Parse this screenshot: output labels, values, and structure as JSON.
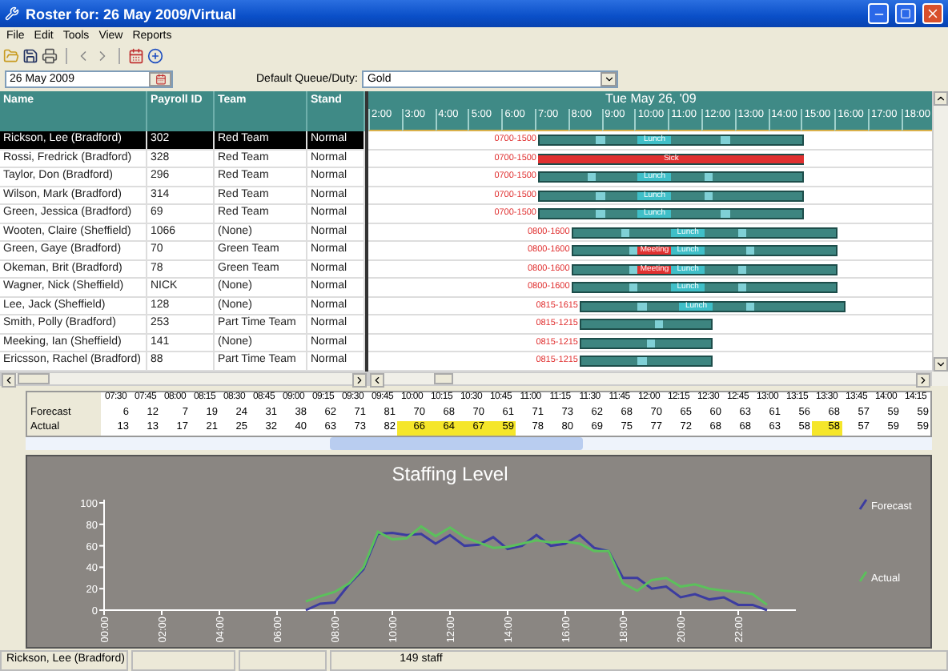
{
  "window": {
    "title": "Roster for: 26 May 2009/Virtual"
  },
  "menu": [
    "File",
    "Edit",
    "Tools",
    "View",
    "Reports"
  ],
  "filter": {
    "date": "26 May 2009",
    "queue_label": "Default Queue/Duty:",
    "queue": "Gold"
  },
  "table": {
    "columns": [
      "Name",
      "Payroll ID",
      "Team",
      "Stand"
    ],
    "rows": [
      {
        "name": "Rickson, Lee  (Bradford)",
        "payroll": "302",
        "team": "Red Team",
        "stand": "Normal",
        "selected": true
      },
      {
        "name": "Rossi, Fredrick  (Bradford)",
        "payroll": "328",
        "team": "Red Team",
        "stand": "Normal",
        "selected": false
      },
      {
        "name": "Taylor, Don  (Bradford)",
        "payroll": "296",
        "team": "Red Team",
        "stand": "Normal",
        "selected": false
      },
      {
        "name": "Wilson, Mark  (Bradford)",
        "payroll": "314",
        "team": "Red Team",
        "stand": "Normal",
        "selected": false
      },
      {
        "name": "Green, Jessica  (Bradford)",
        "payroll": "69",
        "team": "Red Team",
        "stand": "Normal",
        "selected": false
      },
      {
        "name": "Wooten, Claire  (Sheffield)",
        "payroll": "1066",
        "team": "(None)",
        "stand": "Normal",
        "selected": false
      },
      {
        "name": "Green, Gaye  (Bradford)",
        "payroll": "70",
        "team": "Green Team",
        "stand": "Normal",
        "selected": false
      },
      {
        "name": "Okeman, Brit  (Bradford)",
        "payroll": "78",
        "team": "Green Team",
        "stand": "Normal",
        "selected": false
      },
      {
        "name": "Wagner, Nick  (Sheffield)",
        "payroll": "NICK",
        "team": "(None)",
        "stand": "Normal",
        "selected": false
      },
      {
        "name": "Lee, Jack  (Sheffield)",
        "payroll": "128",
        "team": "(None)",
        "stand": "Normal",
        "selected": false
      },
      {
        "name": "Smith, Polly  (Bradford)",
        "payroll": "253",
        "team": "Part Time Team",
        "stand": "Normal",
        "selected": false
      },
      {
        "name": "Meeking, Ian  (Sheffield)",
        "payroll": "141",
        "team": "(None)",
        "stand": "Normal",
        "selected": false
      },
      {
        "name": "Ericsson, Rachel  (Bradford)",
        "payroll": "88",
        "team": "Part Time Team",
        "stand": "Normal",
        "selected": false
      }
    ]
  },
  "schedule": {
    "date": "Tue May 26, '09",
    "hours": [
      "2:00",
      "3:00",
      "4:00",
      "5:00",
      "6:00",
      "7:00",
      "8:00",
      "9:00",
      "10:00",
      "11:00",
      "12:00",
      "13:00",
      "14:00",
      "15:00",
      "16:00",
      "17:00",
      "18:00"
    ],
    "shifts": [
      {
        "label": "0700-1500",
        "events": [
          {
            "kind": "break"
          },
          {
            "kind": "lunch",
            "label": "Lunch"
          },
          {
            "kind": "break"
          }
        ]
      },
      {
        "label": "0700-1500",
        "events": [
          {
            "kind": "sick",
            "label": "Sick"
          }
        ]
      },
      {
        "label": "0700-1500",
        "events": [
          {
            "kind": "break"
          },
          {
            "kind": "lunch",
            "label": "Lunch"
          },
          {
            "kind": "break"
          }
        ]
      },
      {
        "label": "0700-1500",
        "events": [
          {
            "kind": "break"
          },
          {
            "kind": "lunch",
            "label": "Lunch"
          },
          {
            "kind": "break"
          }
        ]
      },
      {
        "label": "0700-1500",
        "events": [
          {
            "kind": "break"
          },
          {
            "kind": "lunch",
            "label": "Lunch"
          },
          {
            "kind": "break"
          }
        ]
      },
      {
        "label": "0800-1600",
        "events": [
          {
            "kind": "break"
          },
          {
            "kind": "lunch",
            "label": "Lunch"
          },
          {
            "kind": "break"
          }
        ]
      },
      {
        "label": "0800-1600",
        "events": [
          {
            "kind": "break"
          },
          {
            "kind": "meeting",
            "label": "Meeting"
          },
          {
            "kind": "lunch",
            "label": "Lunch"
          },
          {
            "kind": "break"
          }
        ]
      },
      {
        "label": "0800-1600",
        "events": [
          {
            "kind": "break"
          },
          {
            "kind": "meeting",
            "label": "Meeting"
          },
          {
            "kind": "lunch",
            "label": "Lunch"
          },
          {
            "kind": "break"
          }
        ]
      },
      {
        "label": "0800-1600",
        "events": [
          {
            "kind": "break"
          },
          {
            "kind": "lunch",
            "label": "Lunch"
          },
          {
            "kind": "break"
          }
        ]
      },
      {
        "label": "0815-1615",
        "events": [
          {
            "kind": "break"
          },
          {
            "kind": "lunch",
            "label": "Lunch"
          },
          {
            "kind": "break"
          }
        ]
      },
      {
        "label": "0815-1215",
        "events": [
          {
            "kind": "break"
          }
        ]
      },
      {
        "label": "0815-1215",
        "events": [
          {
            "kind": "break"
          }
        ]
      },
      {
        "label": "0815-1215",
        "events": [
          {
            "kind": "break"
          }
        ]
      }
    ]
  },
  "intervals": {
    "times": [
      "07:30",
      "07:45",
      "08:00",
      "08:15",
      "08:30",
      "08:45",
      "09:00",
      "09:15",
      "09:30",
      "09:45",
      "10:00",
      "10:15",
      "10:30",
      "10:45",
      "11:00",
      "11:15",
      "11:30",
      "11:45",
      "12:00",
      "12:15",
      "12:30",
      "12:45",
      "13:00",
      "13:15",
      "13:30",
      "13:45",
      "14:00",
      "14:15"
    ],
    "rows": [
      {
        "label": "Forecast",
        "cells": [
          {
            "value": "6",
            "highlighted": false
          },
          {
            "value": "12",
            "highlighted": false
          },
          {
            "value": "7",
            "highlighted": false
          },
          {
            "value": "19",
            "highlighted": false
          },
          {
            "value": "24",
            "highlighted": false
          },
          {
            "value": "31",
            "highlighted": false
          },
          {
            "value": "38",
            "highlighted": false
          },
          {
            "value": "62",
            "highlighted": false
          },
          {
            "value": "71",
            "highlighted": false
          },
          {
            "value": "81",
            "highlighted": false
          },
          {
            "value": "70",
            "highlighted": false
          },
          {
            "value": "68",
            "highlighted": false
          },
          {
            "value": "70",
            "highlighted": false
          },
          {
            "value": "61",
            "highlighted": false
          },
          {
            "value": "71",
            "highlighted": false
          },
          {
            "value": "73",
            "highlighted": false
          },
          {
            "value": "62",
            "highlighted": false
          },
          {
            "value": "68",
            "highlighted": false
          },
          {
            "value": "70",
            "highlighted": false
          },
          {
            "value": "65",
            "highlighted": false
          },
          {
            "value": "60",
            "highlighted": false
          },
          {
            "value": "63",
            "highlighted": false
          },
          {
            "value": "61",
            "highlighted": false
          },
          {
            "value": "56",
            "highlighted": false
          },
          {
            "value": "68",
            "highlighted": false
          },
          {
            "value": "57",
            "highlighted": false
          },
          {
            "value": "59",
            "highlighted": false
          },
          {
            "value": "59",
            "highlighted": false
          }
        ]
      },
      {
        "label": "Actual",
        "cells": [
          {
            "value": "13",
            "highlighted": false
          },
          {
            "value": "13",
            "highlighted": false
          },
          {
            "value": "17",
            "highlighted": false
          },
          {
            "value": "21",
            "highlighted": false
          },
          {
            "value": "25",
            "highlighted": false
          },
          {
            "value": "32",
            "highlighted": false
          },
          {
            "value": "40",
            "highlighted": false
          },
          {
            "value": "63",
            "highlighted": false
          },
          {
            "value": "73",
            "highlighted": false
          },
          {
            "value": "82",
            "highlighted": false
          },
          {
            "value": "66",
            "highlighted": true
          },
          {
            "value": "64",
            "highlighted": true
          },
          {
            "value": "67",
            "highlighted": true
          },
          {
            "value": "59",
            "highlighted": true
          },
          {
            "value": "78",
            "highlighted": false
          },
          {
            "value": "80",
            "highlighted": false
          },
          {
            "value": "69",
            "highlighted": false
          },
          {
            "value": "75",
            "highlighted": false
          },
          {
            "value": "77",
            "highlighted": false
          },
          {
            "value": "72",
            "highlighted": false
          },
          {
            "value": "68",
            "highlighted": false
          },
          {
            "value": "68",
            "highlighted": false
          },
          {
            "value": "63",
            "highlighted": false
          },
          {
            "value": "58",
            "highlighted": false
          },
          {
            "value": "58",
            "highlighted": true
          },
          {
            "value": "57",
            "highlighted": false
          },
          {
            "value": "59",
            "highlighted": false
          },
          {
            "value": "59",
            "highlighted": false
          }
        ]
      }
    ]
  },
  "chart_data": {
    "type": "line",
    "title": "Staffing Level",
    "legend": "right",
    "x": [
      7,
      7.5,
      8,
      8.5,
      9,
      9.5,
      10,
      10.5,
      11,
      11.5,
      12,
      12.5,
      13,
      13.5,
      14,
      14.5,
      15,
      15.5,
      16,
      16.5,
      17,
      17.5,
      18,
      18.5,
      19,
      19.5,
      20,
      20.5,
      21,
      21.5,
      22,
      22.5,
      23
    ],
    "series": [
      {
        "name": "Forecast",
        "color": "#3c3ca0",
        "values": [
          0,
          6,
          7,
          24,
          38,
          71,
          72,
          70,
          71,
          62,
          70,
          60,
          61,
          68,
          57,
          60,
          70,
          60,
          62,
          70,
          58,
          55,
          30,
          30,
          20,
          22,
          12,
          15,
          10,
          12,
          5,
          5,
          0
        ]
      },
      {
        "name": "Actual",
        "color": "#5cc05c",
        "values": [
          8,
          13,
          17,
          25,
          40,
          73,
          66,
          67,
          78,
          69,
          77,
          68,
          63,
          58,
          59,
          62,
          65,
          63,
          64,
          62,
          55,
          55,
          25,
          18,
          28,
          30,
          22,
          24,
          20,
          18,
          17,
          15,
          5
        ]
      }
    ],
    "xlim": [
      0,
      24
    ],
    "ylim": [
      0,
      100
    ],
    "xticks": [
      {
        "value": 0,
        "label": "00:00"
      },
      {
        "value": 2,
        "label": "02:00"
      },
      {
        "value": 4,
        "label": "04:00"
      },
      {
        "value": 6,
        "label": "06:00"
      },
      {
        "value": 8,
        "label": "08:00"
      },
      {
        "value": 10,
        "label": "10:00"
      },
      {
        "value": 12,
        "label": "12:00"
      },
      {
        "value": 14,
        "label": "14:00"
      },
      {
        "value": 16,
        "label": "16:00"
      },
      {
        "value": 18,
        "label": "18:00"
      },
      {
        "value": 20,
        "label": "20:00"
      },
      {
        "value": 22,
        "label": "22:00"
      }
    ],
    "yticks": [
      0,
      20,
      40,
      60,
      80,
      100
    ]
  },
  "status_bar": [
    "Rickson, Lee  (Bradford)",
    "149 staff"
  ]
}
